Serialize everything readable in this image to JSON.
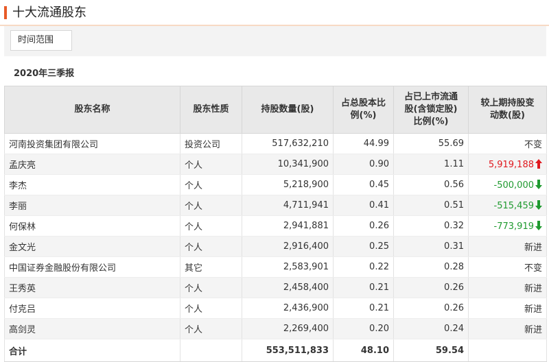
{
  "header": {
    "title": "十大流通股东"
  },
  "range_button": {
    "label": "时间范围"
  },
  "period": "2020年三季报",
  "columns": [
    {
      "lines": [
        "股东名称"
      ]
    },
    {
      "lines": [
        "股东性质"
      ]
    },
    {
      "lines": [
        "持股数量(股)"
      ]
    },
    {
      "lines": [
        "占总股本比",
        "例(%)"
      ]
    },
    {
      "lines": [
        "占已上市流通",
        "股(含锁定股)",
        "比例(%)"
      ]
    },
    {
      "lines": [
        "较上期持股变",
        "动数(股)"
      ]
    }
  ],
  "rows": [
    {
      "name": "河南投资集团有限公司",
      "type": "投资公司",
      "shares": "517,632,210",
      "pct_total": "44.99",
      "pct_float": "55.69",
      "change": "不变",
      "direction": "none"
    },
    {
      "name": "孟庆亮",
      "type": "个人",
      "shares": "10,341,900",
      "pct_total": "0.90",
      "pct_float": "1.11",
      "change": "5,919,188",
      "direction": "up"
    },
    {
      "name": "李杰",
      "type": "个人",
      "shares": "5,218,900",
      "pct_total": "0.45",
      "pct_float": "0.56",
      "change": "-500,000",
      "direction": "down"
    },
    {
      "name": "李丽",
      "type": "个人",
      "shares": "4,711,941",
      "pct_total": "0.41",
      "pct_float": "0.51",
      "change": "-515,459",
      "direction": "down"
    },
    {
      "name": "何保林",
      "type": "个人",
      "shares": "2,941,881",
      "pct_total": "0.26",
      "pct_float": "0.32",
      "change": "-773,919",
      "direction": "down"
    },
    {
      "name": "金文光",
      "type": "个人",
      "shares": "2,916,400",
      "pct_total": "0.25",
      "pct_float": "0.31",
      "change": "新进",
      "direction": "none"
    },
    {
      "name": "中国证券金融股份有限公司",
      "type": "其它",
      "shares": "2,583,901",
      "pct_total": "0.22",
      "pct_float": "0.28",
      "change": "不变",
      "direction": "none"
    },
    {
      "name": "王秀英",
      "type": "个人",
      "shares": "2,458,400",
      "pct_total": "0.21",
      "pct_float": "0.26",
      "change": "新进",
      "direction": "none"
    },
    {
      "name": "付克吕",
      "type": "个人",
      "shares": "2,436,900",
      "pct_total": "0.21",
      "pct_float": "0.26",
      "change": "新进",
      "direction": "none"
    },
    {
      "name": "高剑灵",
      "type": "个人",
      "shares": "2,269,400",
      "pct_total": "0.20",
      "pct_float": "0.24",
      "change": "新进",
      "direction": "none"
    }
  ],
  "total": {
    "label": "合计",
    "shares": "553,511,833",
    "pct_total": "48.10",
    "pct_float": "59.54"
  },
  "colors": {
    "accent": "#e85a27",
    "up": "#e0191f",
    "down": "#1f9a2f",
    "header_bg": "#e9e9e9"
  },
  "icons": {
    "up": "arrow-up-icon",
    "down": "arrow-down-icon"
  }
}
